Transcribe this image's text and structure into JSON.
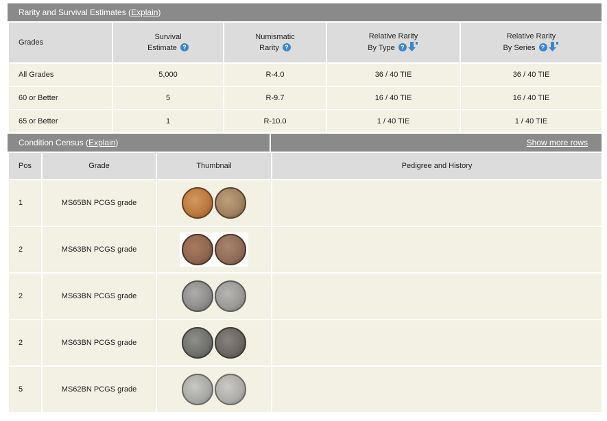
{
  "rarity": {
    "title_prefix": "Rarity and Survival Estimates (",
    "explain_link": "Explain",
    "title_suffix": ")",
    "headers": {
      "grades": "Grades",
      "survival_line1": "Survival",
      "survival_line2": "Estimate",
      "numismatic_line1": "Numismatic",
      "numismatic_line2": "Rarity",
      "rel_type_line1": "Relative Rarity",
      "rel_type_line2": "By Type",
      "rel_series_line1": "Relative Rarity",
      "rel_series_line2": "By Series"
    },
    "rows": [
      {
        "grade": "All Grades",
        "survival": "5,000",
        "numismatic": "R-4.0",
        "by_type": "36 / 40 TIE",
        "by_series": "36 / 40 TIE"
      },
      {
        "grade": "60 or Better",
        "survival": "5",
        "numismatic": "R-9.7",
        "by_type": "16 / 40 TIE",
        "by_series": "16 / 40 TIE"
      },
      {
        "grade": "65 or Better",
        "survival": "1",
        "numismatic": "R-10.0",
        "by_type": "1 / 40 TIE",
        "by_series": "1 / 40 TIE"
      }
    ]
  },
  "census": {
    "title_prefix": "Condition Census (",
    "explain_link": "Explain",
    "title_suffix": ")",
    "show_more": "Show more rows",
    "headers": {
      "pos": "Pos",
      "grade": "Grade",
      "thumbnail": "Thumbnail",
      "pedigree": "Pedigree and History"
    },
    "rows": [
      {
        "pos": "1",
        "grade": "MS65BN PCGS grade",
        "pedigree": "",
        "obv": "#b9773f",
        "rev": "#a08060",
        "bg": false
      },
      {
        "pos": "2",
        "grade": "MS63BN PCGS grade",
        "pedigree": "",
        "obv": "#8e6650",
        "rev": "#8d6c58",
        "bg": true
      },
      {
        "pos": "2",
        "grade": "MS63BN PCGS grade",
        "pedigree": "",
        "obv": "#8d8c8a",
        "rev": "#9b9996",
        "bg": false
      },
      {
        "pos": "2",
        "grade": "MS63BN PCGS grade",
        "pedigree": "",
        "obv": "#6f6f6b",
        "rev": "#6a6560",
        "bg": false
      },
      {
        "pos": "5",
        "grade": "MS62BN PCGS grade",
        "pedigree": "",
        "obv": "#a8a8a5",
        "rev": "#adaca8",
        "bg": false
      }
    ]
  }
}
